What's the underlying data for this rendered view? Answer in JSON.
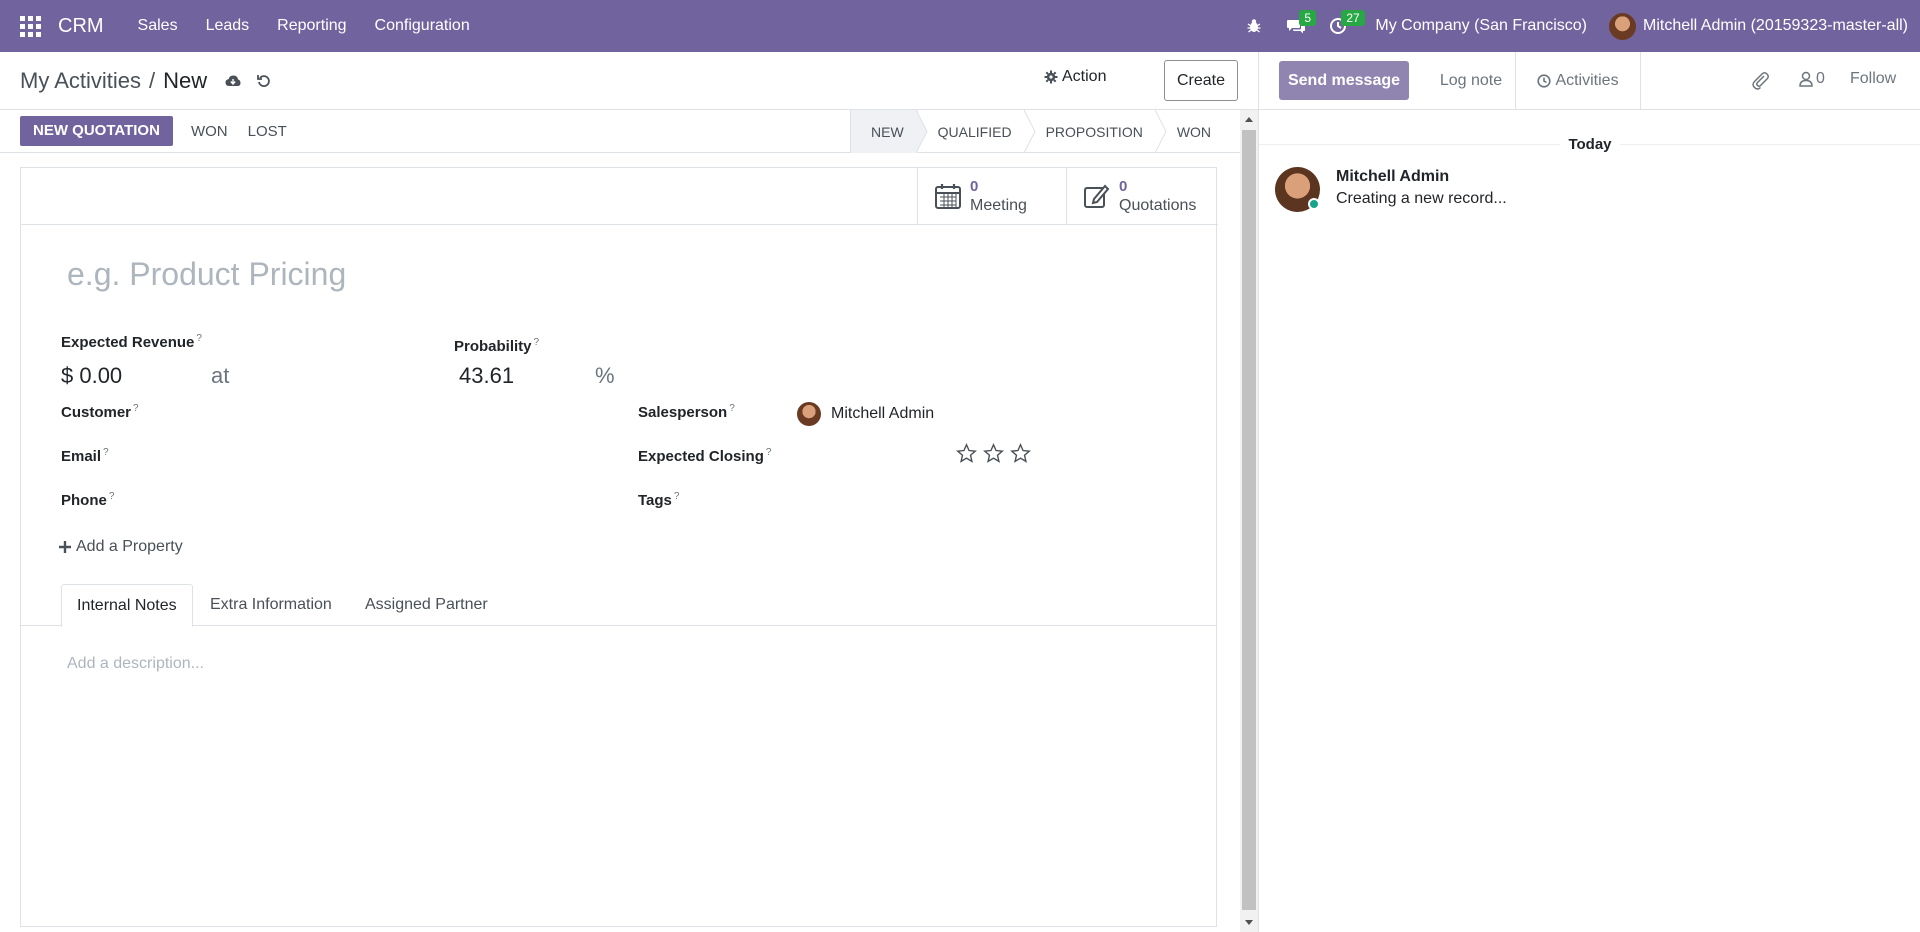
{
  "navbar": {
    "app_name": "CRM",
    "menu": [
      "Sales",
      "Leads",
      "Reporting",
      "Configuration"
    ],
    "messages_badge": "5",
    "activities_badge": "27",
    "company": "My Company (San Francisco)",
    "user": "Mitchell Admin (20159323-master-all)"
  },
  "control": {
    "breadcrumb_parent": "My Activities",
    "breadcrumb_separator": "/",
    "breadcrumb_current": "New",
    "action_label": "Action",
    "create_label": "Create"
  },
  "statusbar": {
    "primary_button": "NEW QUOTATION",
    "won_button": "WON",
    "lost_button": "LOST",
    "stages": [
      "NEW",
      "QUALIFIED",
      "PROPOSITION",
      "WON"
    ],
    "active_stage": "NEW"
  },
  "smart_buttons": {
    "meeting_count": "0",
    "meeting_label": "Meeting",
    "quotations_count": "0",
    "quotations_label": "Quotations"
  },
  "form": {
    "title_placeholder": "e.g. Product Pricing",
    "expected_revenue_label": "Expected Revenue",
    "expected_revenue_value": "$ 0.00",
    "at_label": "at",
    "probability_label": "Probability",
    "probability_value": "43.61",
    "percent_sign": "%",
    "customer_label": "Customer",
    "email_label": "Email",
    "phone_label": "Phone",
    "salesperson_label": "Salesperson",
    "salesperson_value": "Mitchell Admin",
    "expected_closing_label": "Expected Closing",
    "tags_label": "Tags",
    "help_mark": "?",
    "add_property": "Add a Property",
    "priority_stars": 3
  },
  "tabs": {
    "items": [
      "Internal Notes",
      "Extra Information",
      "Assigned Partner"
    ],
    "active": "Internal Notes",
    "description_placeholder": "Add a description..."
  },
  "chatter": {
    "send_message": "Send message",
    "log_note": "Log note",
    "activities": "Activities",
    "followers_count": "0",
    "follow": "Follow",
    "date_separator": "Today",
    "message_author": "Mitchell Admin",
    "message_text": "Creating a new record..."
  },
  "colors": {
    "brand": "#71639e",
    "badge": "#28a745",
    "online": "#17a589"
  }
}
